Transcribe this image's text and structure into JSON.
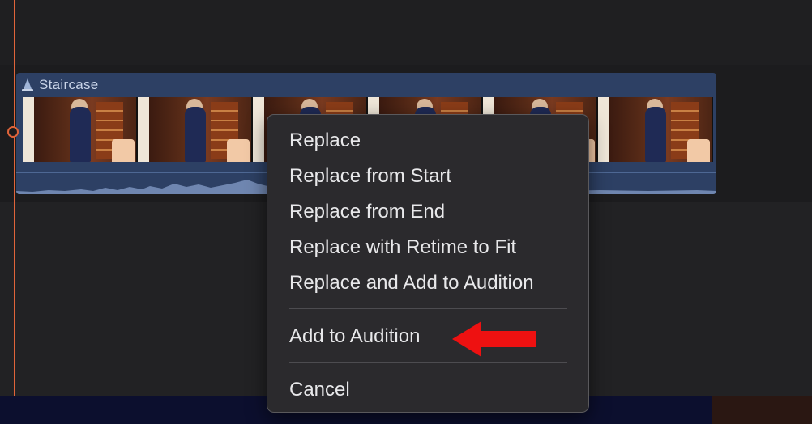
{
  "clip": {
    "title": "Staircase",
    "icon": "audition-icon",
    "thumbnail_count": 6
  },
  "context_menu": {
    "items": [
      {
        "label": "Replace"
      },
      {
        "label": "Replace from Start"
      },
      {
        "label": "Replace from End"
      },
      {
        "label": "Replace with Retime to Fit"
      },
      {
        "label": "Replace and Add to Audition"
      },
      {
        "label": "Add to Audition",
        "highlighted_by": "red-arrow-icon"
      },
      {
        "label": "Cancel"
      }
    ]
  },
  "colors": {
    "playhead": "#e0643a",
    "clip": "#2d4064",
    "arrow": "#ee1111",
    "menu_bg": "#2b2a2d"
  }
}
